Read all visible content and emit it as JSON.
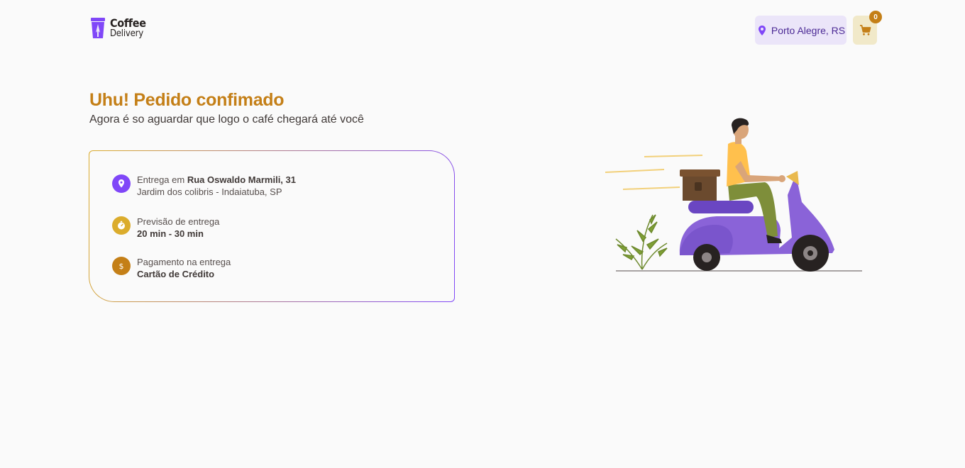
{
  "header": {
    "logo": {
      "line1": "Coffee",
      "line2": "Delivery"
    },
    "location": {
      "label": "Porto Alegre, RS",
      "icon": "map-pin-icon"
    },
    "cart": {
      "count": "0",
      "icon": "shopping-cart-icon"
    }
  },
  "main": {
    "title": "Uhu! Pedido confimado",
    "subtitle": "Agora é so aguardar que logo o café chegará até você",
    "info": {
      "delivery": {
        "prefix": "Entrega em ",
        "street": "Rua Oswaldo Marmili, 31",
        "district": "Jardim dos colibris - Indaiatuba, SP",
        "icon": "map-pin-icon",
        "color": "#8047F8"
      },
      "forecast": {
        "label": "Previsão de entrega",
        "value": "20 min - 30 min",
        "icon": "timer-icon",
        "color": "#DBAC2C"
      },
      "payment": {
        "label": "Pagamento na entrega",
        "value": "Cartão de Crédito",
        "icon": "currency-dollar-icon",
        "color": "#C47F17"
      }
    }
  },
  "colors": {
    "brand_yellow_dark": "#C47F17",
    "brand_yellow": "#DBAC2C",
    "brand_purple": "#8047F8",
    "brand_purple_dark": "#4B2995",
    "purple_light": "#EBE5F9",
    "yellow_light": "#F1E9C9"
  }
}
